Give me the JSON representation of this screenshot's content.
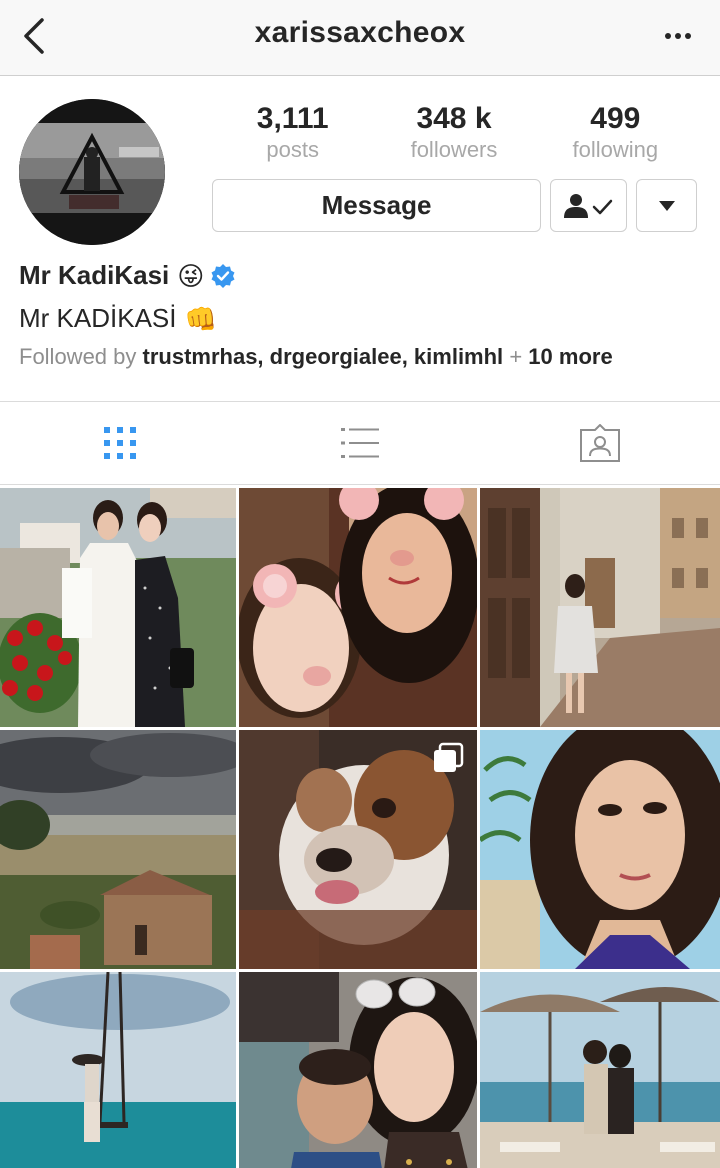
{
  "header": {
    "username": "xarissaxcheox",
    "back_icon": "chevron-left-icon",
    "more_icon": "ellipsis-icon"
  },
  "stats": [
    {
      "value": "3,111",
      "label": "posts"
    },
    {
      "value": "348 k",
      "label": "followers"
    },
    {
      "value": "499",
      "label": "following"
    }
  ],
  "actions": {
    "message_label": "Message",
    "following_icon": "person-check-icon",
    "dropdown_icon": "triangle-down-icon"
  },
  "profile": {
    "name": "Mr KadiKasi",
    "name_emoji": "😜",
    "verified_icon": "verified-badge-icon",
    "bio_text": "Mr KADİKASİ",
    "bio_emoji": "👊",
    "followed_prefix": "Followed by",
    "followed_names": "trustmrhas, drgeorgialee, kimlimhl",
    "followed_plus": "+",
    "followed_more": "10 more"
  },
  "tabs": [
    {
      "icon": "grid-icon",
      "active": true
    },
    {
      "icon": "list-icon",
      "active": false
    },
    {
      "icon": "tagged-person-icon",
      "active": false
    }
  ],
  "colors": {
    "accent": "#3897f0",
    "border": "#dbdbdb",
    "muted_text": "#8e8e8e"
  },
  "posts": [
    {
      "subject": "two-women-garden"
    },
    {
      "subject": "selfie-bear-filter"
    },
    {
      "subject": "woman-old-town-square"
    },
    {
      "subject": "tuscany-landscape"
    },
    {
      "subject": "bulldog",
      "multi_photo_icon": "carousel-icon"
    },
    {
      "subject": "woman-selfie-beach"
    },
    {
      "subject": "woman-beach-swing"
    },
    {
      "subject": "woman-with-baby"
    },
    {
      "subject": "beach-cafe-women"
    }
  ]
}
